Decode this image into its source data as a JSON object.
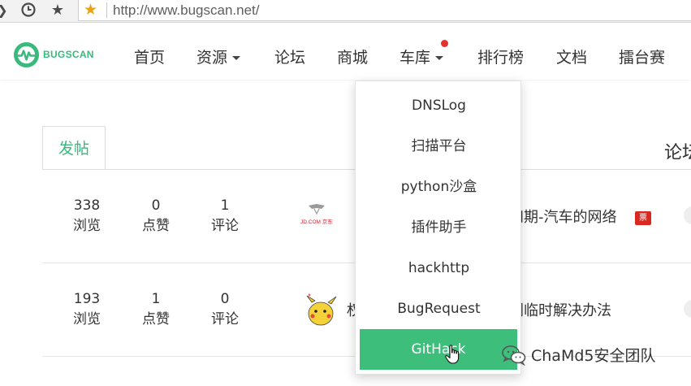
{
  "browser": {
    "url": "http://www.bugscan.net/"
  },
  "brand": {
    "name": "BUGSCAN",
    "accent": "#3ab97c"
  },
  "nav": {
    "items": [
      {
        "label": "首页",
        "has_caret": false
      },
      {
        "label": "资源",
        "has_caret": true
      },
      {
        "label": "论坛",
        "has_caret": false
      },
      {
        "label": "商城",
        "has_caret": false
      },
      {
        "label": "车库",
        "has_caret": true,
        "notification_dot": true
      },
      {
        "label": "排行榜",
        "has_caret": false
      },
      {
        "label": "文档",
        "has_caret": false
      },
      {
        "label": "擂台赛",
        "has_caret": false
      }
    ]
  },
  "dropdown": {
    "items": [
      {
        "label": "DNSLog"
      },
      {
        "label": "扫描平台"
      },
      {
        "label": "python沙盒"
      },
      {
        "label": "插件助手"
      },
      {
        "label": "hackhttp"
      },
      {
        "label": "BugRequest"
      },
      {
        "label": "GitHack",
        "active": true
      }
    ]
  },
  "content": {
    "tab_label": "发帖",
    "side_title": "论坛",
    "posts": [
      {
        "views": "338",
        "views_label": "浏览",
        "likes": "0",
        "likes_label": "点赞",
        "comments": "1",
        "comments_label": "评论",
        "avatar_text": "JD.COM 京东",
        "title": "四期-汽车的网络",
        "badge": "票"
      },
      {
        "views": "193",
        "views_label": "浏览",
        "likes": "1",
        "likes_label": "点赞",
        "comments": "0",
        "comments_label": "评论",
        "title_left": "权",
        "title": "剧临时解决办法"
      }
    ]
  },
  "watermark": {
    "text": "ChaMd5安全团队"
  }
}
